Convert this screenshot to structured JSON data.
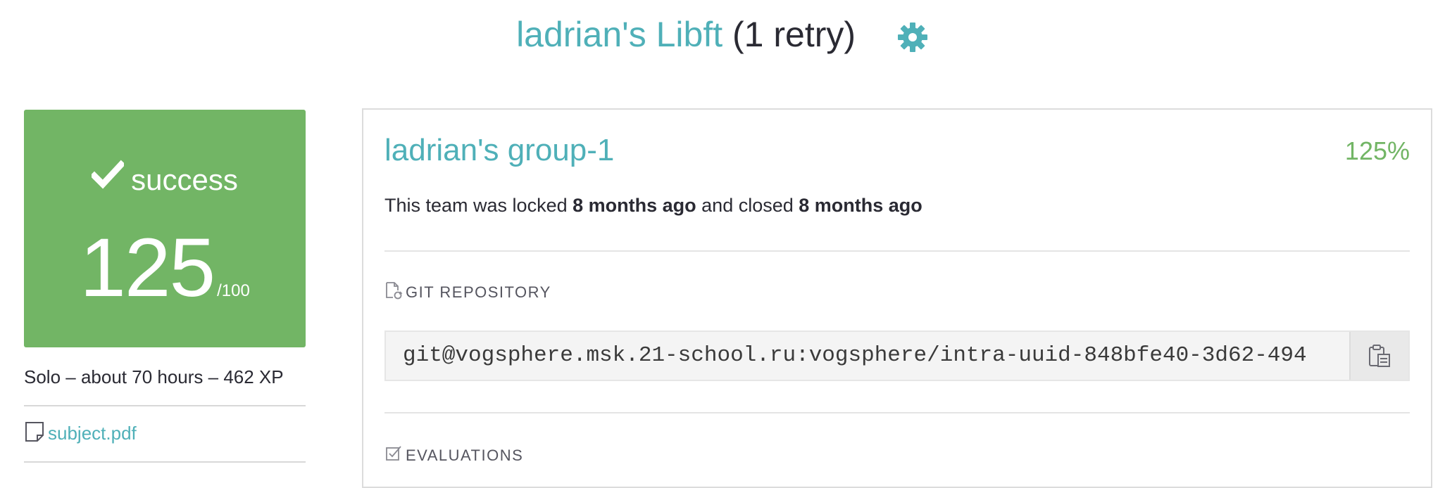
{
  "header": {
    "project_name": "ladrian's Libft",
    "retry_text": "(1 retry)"
  },
  "result": {
    "status_label": "success",
    "score": "125",
    "score_max": "/100",
    "meta": "Solo – about 70 hours – 462 XP",
    "subject_link": "subject.pdf"
  },
  "team": {
    "name": "ladrian's group-1",
    "percentage": "125%",
    "status_prefix": "This team was locked",
    "locked_time": "8 months ago",
    "status_middle": "and closed",
    "closed_time": "8 months ago"
  },
  "git": {
    "section_label": "GIT REPOSITORY",
    "repo_url": "git@vogsphere.msk.21-school.ru:vogsphere/intra-uuid-848bfe40-3d62-494"
  },
  "evaluations": {
    "section_label": "EVALUATIONS"
  },
  "colors": {
    "accent_teal": "#4fb0b8",
    "success_green": "#72b565"
  },
  "icons": {
    "settings": "gear-icon",
    "status": "check-icon",
    "subject": "file-icon",
    "git": "git-file-icon",
    "evaluations": "checkbox-icon",
    "copy": "clipboard-icon"
  }
}
